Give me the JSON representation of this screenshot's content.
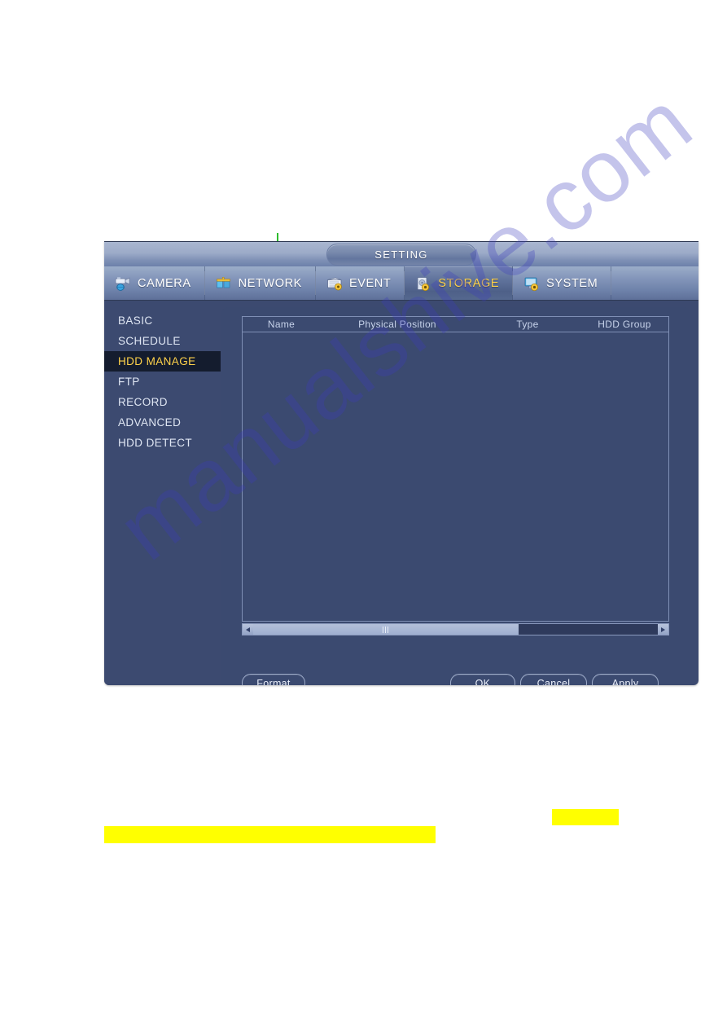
{
  "window": {
    "title": "SETTING",
    "tabs": [
      {
        "label": "CAMERA",
        "icon": "camera-icon",
        "active": false
      },
      {
        "label": "NETWORK",
        "icon": "network-icon",
        "active": false
      },
      {
        "label": "EVENT",
        "icon": "event-icon",
        "active": false
      },
      {
        "label": "STORAGE",
        "icon": "storage-icon",
        "active": true
      },
      {
        "label": "SYSTEM",
        "icon": "system-icon",
        "active": false
      }
    ]
  },
  "sidebar": {
    "items": [
      {
        "label": "BASIC",
        "active": false
      },
      {
        "label": "SCHEDULE",
        "active": false
      },
      {
        "label": "HDD MANAGE",
        "active": true
      },
      {
        "label": "FTP",
        "active": false
      },
      {
        "label": "RECORD",
        "active": false
      },
      {
        "label": "ADVANCED",
        "active": false
      },
      {
        "label": "HDD DETECT",
        "active": false
      }
    ]
  },
  "table": {
    "columns": [
      "Name",
      "Physical Position",
      "Type",
      "HDD Group"
    ],
    "rows": []
  },
  "scrollbar": {
    "left_arrow": "◀",
    "right_arrow": "▶",
    "thumb_percent": 65
  },
  "buttons": {
    "format": "Format",
    "ok": "OK",
    "cancel": "Cancel",
    "apply": "Apply"
  },
  "watermark": {
    "text": "manualshive.com"
  },
  "colors": {
    "dialog_body": "#3c4a70",
    "active_tab_text": "#ffd24a",
    "active_sidebar_bg": "#141c2e",
    "highlight": "#ffff00",
    "green_marker": "#2ebd2e"
  }
}
